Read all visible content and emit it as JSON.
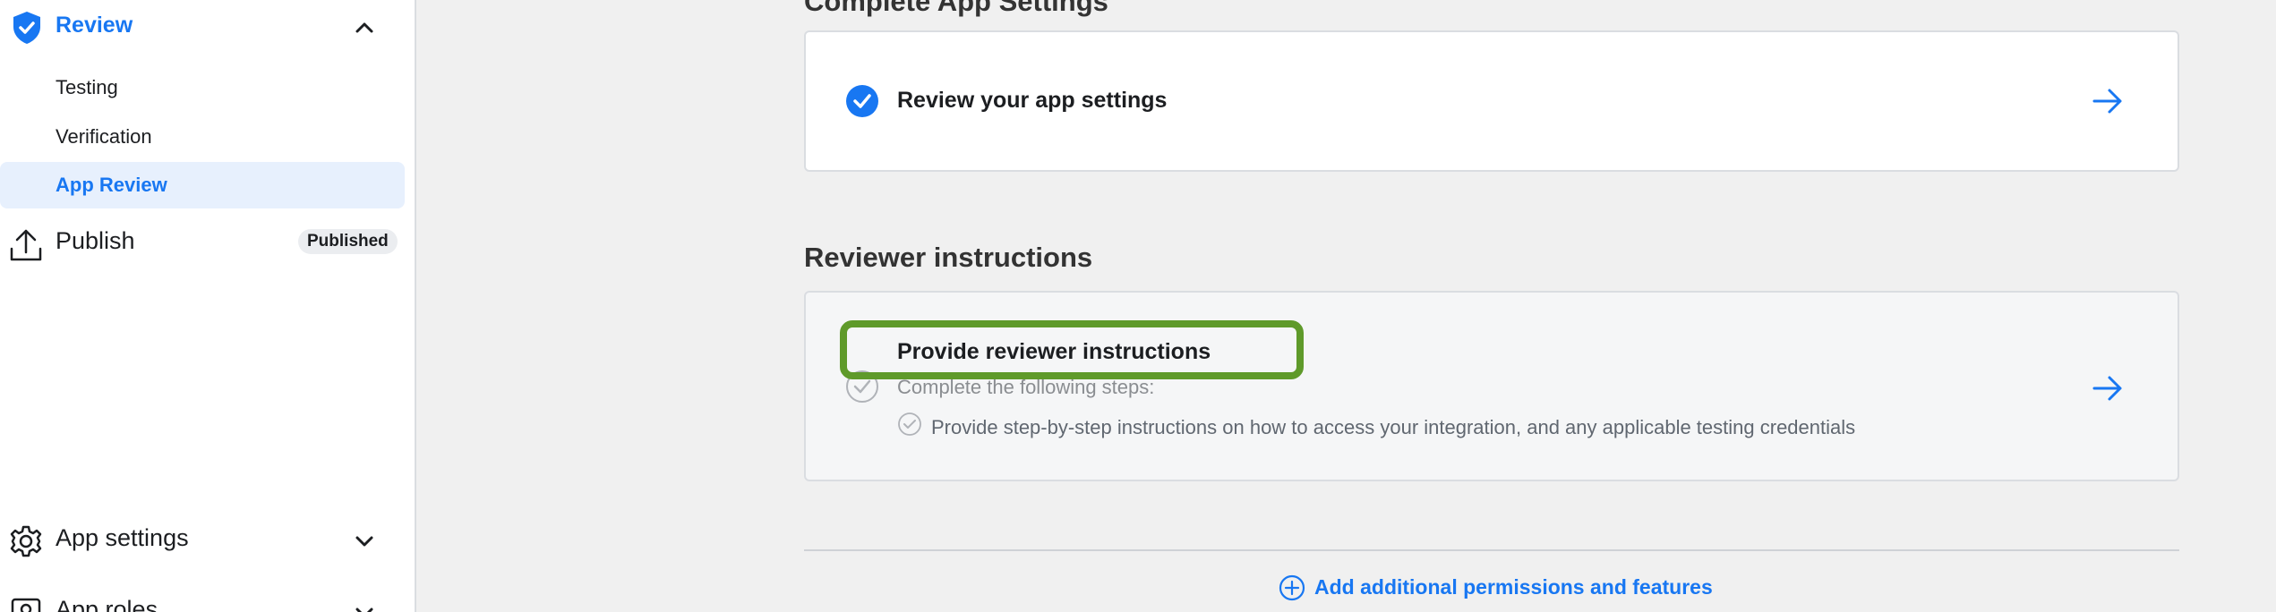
{
  "colors": {
    "accent": "#1877f2",
    "highlight": "#5f9a2a",
    "muted_text": "#8a8d91"
  },
  "sidebar": {
    "review": {
      "label": "Review",
      "icon": "shield-check-icon",
      "expanded": true
    },
    "review_items": [
      {
        "label": "Testing",
        "active": false
      },
      {
        "label": "Verification",
        "active": false
      },
      {
        "label": "App Review",
        "active": true
      }
    ],
    "publish": {
      "label": "Publish",
      "icon": "upload-icon",
      "badge": "Published"
    },
    "app_settings": {
      "label": "App settings",
      "icon": "gear-icon"
    },
    "app_roles": {
      "label": "App roles",
      "icon": "roles-icon"
    }
  },
  "main": {
    "complete_settings_title": "Complete App Settings",
    "review_settings_card": {
      "title": "Review your app settings",
      "done": true
    },
    "reviewer_section_title": "Reviewer instructions",
    "reviewer_card": {
      "title": "Provide reviewer instructions",
      "subtitle": "Complete the following steps:",
      "steps": [
        "Provide step-by-step instructions on how to access your integration, and any applicable testing credentials"
      ]
    },
    "add_link": "Add additional permissions and features"
  }
}
